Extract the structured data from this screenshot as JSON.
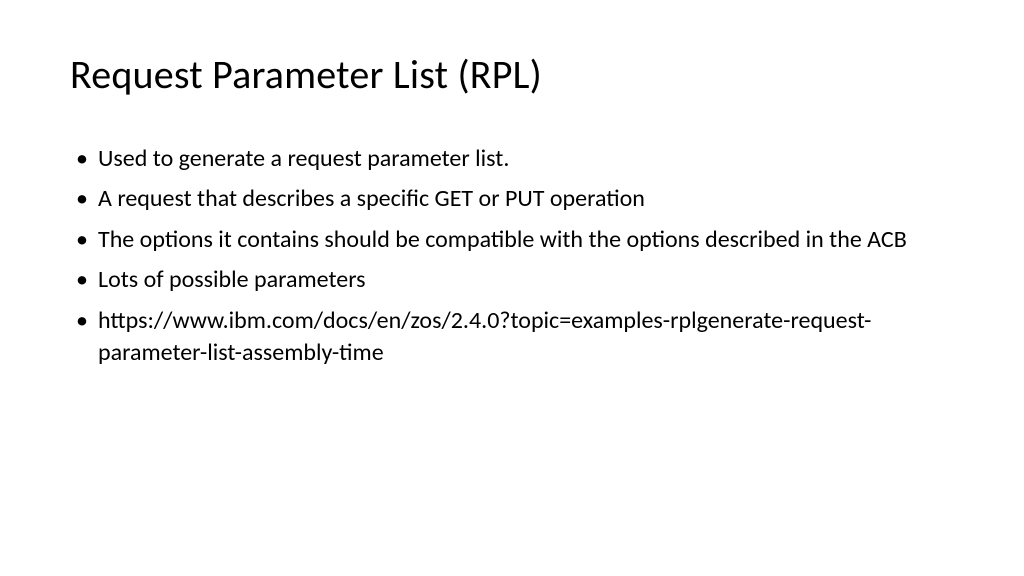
{
  "slide": {
    "title": "Request Parameter List (RPL)",
    "bullets": [
      "Used to generate a request parameter list.",
      "A request that describes a specific GET or PUT operation",
      "The options it contains should be compatible with the options described in the ACB",
      "Lots of possible parameters",
      "https://www.ibm.com/docs/en/zos/2.4.0?topic=examples-rplgenerate-request-parameter-list-assembly-time"
    ]
  }
}
